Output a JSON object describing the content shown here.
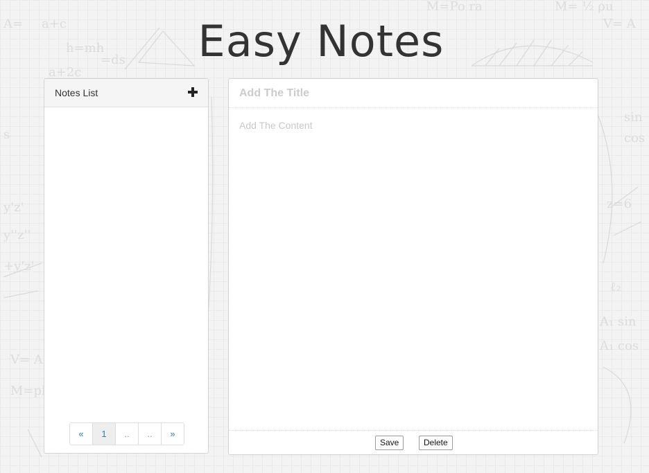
{
  "app": {
    "title": "Easy Notes"
  },
  "notes_list": {
    "header": "Notes List",
    "add_icon": "plus-icon",
    "items": [],
    "pagination": {
      "prev": "«",
      "pages": [
        "1",
        "..",
        ".."
      ],
      "next": "»",
      "current": "1"
    }
  },
  "editor": {
    "title_placeholder": "Add The Title",
    "title_value": "",
    "content_placeholder": "Add The Content",
    "content_value": "",
    "save_label": "Save",
    "delete_label": "Delete"
  },
  "colors": {
    "link": "#337ab7",
    "title_text": "#333333",
    "placeholder": "#cccccc"
  }
}
